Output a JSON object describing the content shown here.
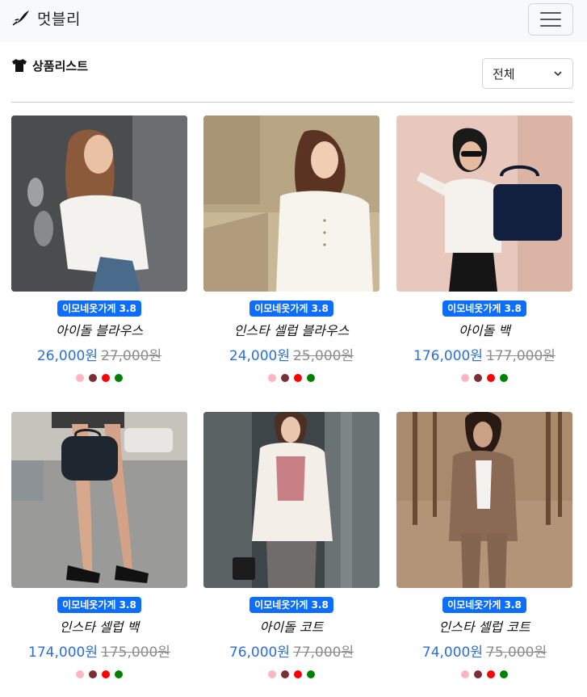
{
  "navbar": {
    "brand_text": "멋블리",
    "brand_icon": "feather-brush-icon",
    "toggler_icon": "hamburger-menu-icon"
  },
  "header": {
    "title": "상품리스트",
    "title_icon": "tshirt-icon",
    "filter_value": "전체"
  },
  "products": [
    {
      "badge": "이모네옷가게 3.8",
      "name": "아이돌 블라우스",
      "price": "26,000원",
      "old_price": "27,000원"
    },
    {
      "badge": "이모네옷가게 3.8",
      "name": "인스타 셀럽 블라우스",
      "price": "24,000원",
      "old_price": "25,000원"
    },
    {
      "badge": "이모네옷가게 3.8",
      "name": "아이돌 백",
      "price": "176,000원",
      "old_price": "177,000원"
    },
    {
      "badge": "이모네옷가게 3.8",
      "name": "인스타 셀럽 백",
      "price": "174,000원",
      "old_price": "175,000원"
    },
    {
      "badge": "이모네옷가게 3.8",
      "name": "아이돌 코트",
      "price": "76,000원",
      "old_price": "77,000원"
    },
    {
      "badge": "이모네옷가게 3.8",
      "name": "인스타 셀럽 코트",
      "price": "74,000원",
      "old_price": "75,000원"
    }
  ],
  "colors": {
    "accent": "#0d6efd",
    "price": "#2b6fd6",
    "swatches": [
      "#ffb6c1",
      "#7a2e36",
      "#ff0000",
      "#008000"
    ]
  }
}
